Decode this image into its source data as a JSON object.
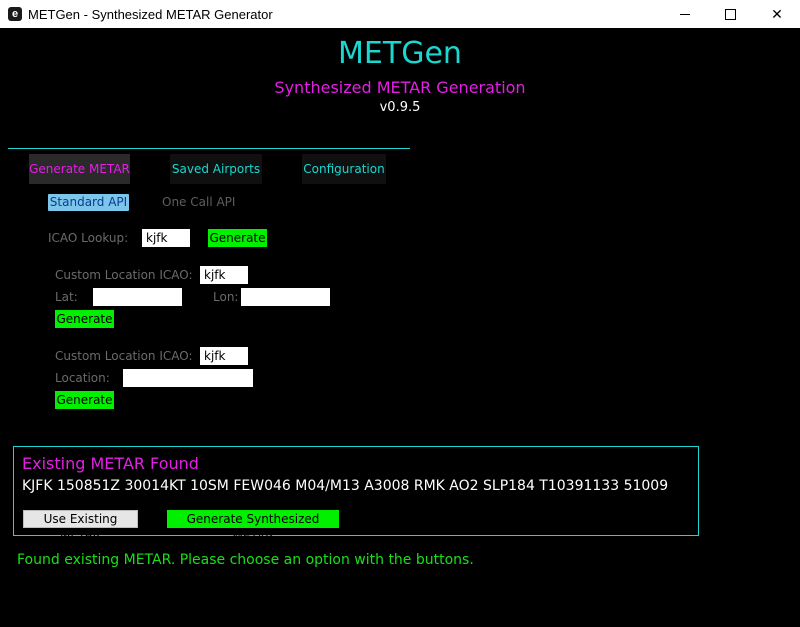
{
  "window": {
    "icon_letter": "e",
    "title": "METGen - Synthesized METAR Generator",
    "close_glyph": "✕"
  },
  "header": {
    "app_name": "METGen",
    "subtitle": "Synthesized METAR Generation",
    "version": "v0.9.5"
  },
  "tabs": [
    {
      "label": "Generate METAR",
      "active": true
    },
    {
      "label": "Saved Airports",
      "active": false
    },
    {
      "label": "Configuration",
      "active": false
    }
  ],
  "api_tabs": [
    {
      "label": "Standard API",
      "active": true
    },
    {
      "label": "One Call API",
      "active": false
    }
  ],
  "icao_lookup": {
    "label": "ICAO Lookup:",
    "value": "kjfk",
    "button": "Generate"
  },
  "latlon_form": {
    "icao_label": "Custom Location ICAO:",
    "icao_value": "kjfk",
    "lat_label": "Lat:",
    "lat_value": "",
    "lon_label": "Lon:",
    "lon_value": "",
    "button": "Generate"
  },
  "location_form": {
    "icao_label": "Custom Location ICAO:",
    "icao_value": "kjfk",
    "location_label": "Location:",
    "location_value": "",
    "button": "Generate"
  },
  "result": {
    "title": "Existing METAR Found",
    "metar": "KJFK 150851Z 30014KT 10SM FEW046 M04/M13 A3008 RMK AO2 SLP184 T10391133 51009",
    "use_existing_button": "Use Existing METAR",
    "generate_synth_button": "Generate Synthesized METAR"
  },
  "status_message": "Found existing METAR. Please choose an option with the buttons.",
  "colors": {
    "accent_cyan": "#1ad7d0",
    "accent_magenta": "#e51ee5",
    "button_green": "#00f000",
    "status_green": "#18e018",
    "background": "#000000"
  }
}
